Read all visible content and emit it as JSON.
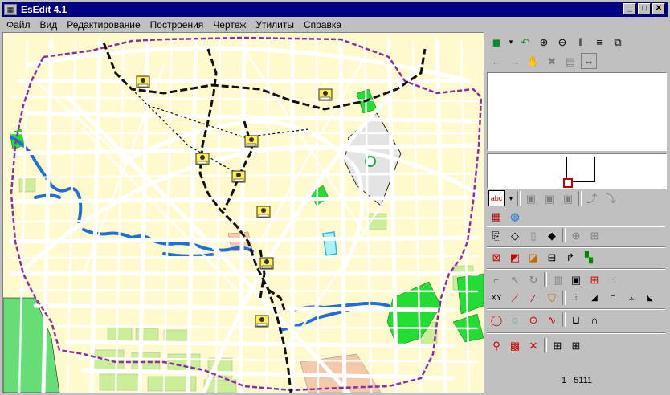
{
  "window": {
    "title": "EsEdit 4.1",
    "controls": {
      "minimize": "_",
      "maximize": "□",
      "close": "✕"
    }
  },
  "menu": [
    "Файл",
    "Вид",
    "Редактирование",
    "Построения",
    "Чертеж",
    "Утилиты",
    "Справка"
  ],
  "toolbar": {
    "row1": [
      "layers-icon",
      "dropdown-icon",
      "undo-icon",
      "zoom-in-icon",
      "zoom-out-icon",
      "ruler-icon",
      "layer-list-icon",
      "copy-icon"
    ],
    "row2": [
      "back-arrow-icon",
      "forward-arrow-icon",
      "pan-hand-icon",
      "delete-icon",
      "list-icon",
      "swap-icon"
    ]
  },
  "status": {
    "scale": "1 : 5111"
  },
  "colors": {
    "titlebar": "#000080",
    "map_background": "#fffacd",
    "road": "#ffffff",
    "water": "#1e6fd9",
    "park": "#2ecc40",
    "boundary": "#8b2fa8",
    "railway": "#111111"
  }
}
